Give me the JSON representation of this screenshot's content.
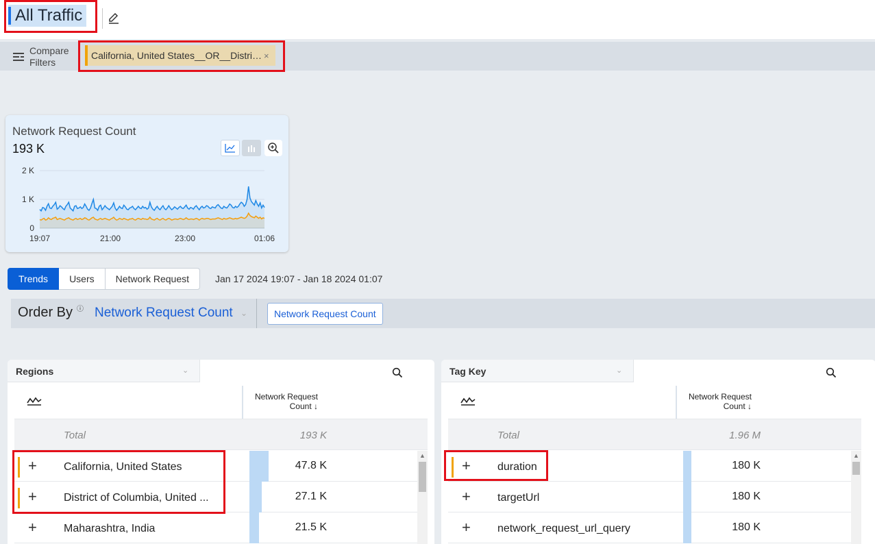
{
  "header": {
    "title": "All Traffic",
    "edit_icon": "edit-icon"
  },
  "filters": {
    "compare_label": "Compare Filters",
    "chip_text": "California, United States__OR__District of Columbia, United States",
    "chip_close": "×",
    "chip_color": "#f0a30a"
  },
  "card": {
    "title": "Network Request Count",
    "value": "193 K"
  },
  "chart_data": {
    "type": "line",
    "title": "Network Request Count",
    "ylim": [
      0,
      2000
    ],
    "yticks": [
      "0",
      "1 K",
      "2 K"
    ],
    "xticks": [
      "19:07",
      "21:00",
      "23:00",
      "01:06"
    ],
    "series": [
      {
        "name": "",
        "color": "#1e88e5",
        "values": [
          650,
          600,
          720,
          700,
          620,
          760,
          850,
          700,
          680,
          760,
          820,
          900,
          660,
          700,
          780,
          740,
          680,
          640,
          760,
          820,
          900,
          700,
          650,
          600,
          760,
          780,
          680,
          700,
          740,
          680,
          720,
          840,
          760,
          660,
          620,
          700,
          860,
          1000,
          700,
          680,
          620,
          760,
          800,
          640,
          700,
          780,
          720,
          680,
          640,
          700,
          760,
          880,
          700,
          620,
          680,
          760,
          700,
          680,
          800,
          740,
          660,
          640,
          700,
          720,
          760,
          680,
          640,
          700,
          760,
          700,
          680,
          760,
          700,
          720,
          660,
          700,
          900,
          740,
          660,
          620,
          700,
          760,
          680,
          640,
          720,
          780,
          680,
          640,
          700,
          780,
          700,
          640,
          680,
          740,
          700,
          660,
          720,
          760,
          700,
          680,
          740,
          800,
          700,
          660,
          720,
          700,
          660,
          740,
          780,
          700,
          640,
          720,
          760,
          700,
          720,
          780,
          760,
          700,
          680,
          740,
          720,
          700,
          780,
          820,
          760,
          700,
          680,
          760,
          720,
          700,
          760,
          840,
          800,
          720,
          700,
          760,
          720,
          760,
          840,
          900,
          860,
          760,
          820,
          1000,
          1450,
          1050,
          920,
          860,
          800,
          960,
          840,
          760,
          880,
          700,
          800,
          720
        ]
      },
      {
        "name": "",
        "color": "#f59e0b",
        "values": [
          300,
          280,
          320,
          340,
          280,
          300,
          360,
          320,
          300,
          340,
          360,
          380,
          300,
          320,
          340,
          320,
          300,
          280,
          320,
          340,
          360,
          320,
          300,
          280,
          320,
          340,
          300,
          320,
          340,
          300,
          320,
          360,
          340,
          300,
          280,
          320,
          360,
          380,
          320,
          300,
          280,
          320,
          340,
          300,
          320,
          340,
          320,
          300,
          280,
          320,
          340,
          380,
          320,
          280,
          300,
          340,
          320,
          300,
          340,
          320,
          300,
          280,
          320,
          320,
          340,
          300,
          280,
          320,
          340,
          320,
          300,
          340,
          320,
          320,
          300,
          320,
          380,
          320,
          300,
          280,
          320,
          340,
          300,
          280,
          320,
          340,
          300,
          280,
          320,
          340,
          320,
          280,
          300,
          320,
          320,
          300,
          320,
          340,
          320,
          300,
          320,
          360,
          320,
          300,
          320,
          320,
          300,
          320,
          340,
          320,
          280,
          320,
          340,
          320,
          320,
          340,
          340,
          320,
          300,
          320,
          320,
          320,
          340,
          360,
          340,
          320,
          300,
          340,
          320,
          320,
          340,
          360,
          340,
          320,
          320,
          340,
          320,
          340,
          360,
          380,
          360,
          340,
          360,
          420,
          520,
          440,
          400,
          380,
          360,
          420,
          380,
          340,
          380,
          320,
          360,
          340
        ]
      }
    ]
  },
  "tabs": [
    {
      "label": "Trends",
      "active": true
    },
    {
      "label": "Users",
      "active": false
    },
    {
      "label": "Network Request",
      "active": false
    }
  ],
  "date_range": "Jan 17 2024 19:07 - Jan 18 2024 01:07",
  "order_by": {
    "label": "Order By",
    "info": "ⓘ",
    "selected": "Network Request Count",
    "button": "Network Request Count"
  },
  "left_panel": {
    "dimension": "Regions",
    "column_header": "Network Request Count ↓",
    "total_label": "Total",
    "total_value": "193 K",
    "rows": [
      {
        "label": "California, United States",
        "value": "47.8 K",
        "fraction": 0.222,
        "marked": true
      },
      {
        "label": "District of Columbia, United ...",
        "value": "27.1 K",
        "fraction": 0.14,
        "marked": true
      },
      {
        "label": "Maharashtra, India",
        "value": "21.5 K",
        "fraction": 0.111,
        "marked": false
      }
    ]
  },
  "right_panel": {
    "dimension": "Tag Key",
    "column_header": "Network Request Count ↓",
    "total_label": "Total",
    "total_value": "1.96 M",
    "rows": [
      {
        "label": "duration",
        "value": "180 K",
        "fraction": 0.092,
        "marked": true
      },
      {
        "label": "targetUrl",
        "value": "180 K",
        "fraction": 0.092,
        "marked": false
      },
      {
        "label": "network_request_url_query",
        "value": "180 K",
        "fraction": 0.092,
        "marked": false
      }
    ]
  }
}
